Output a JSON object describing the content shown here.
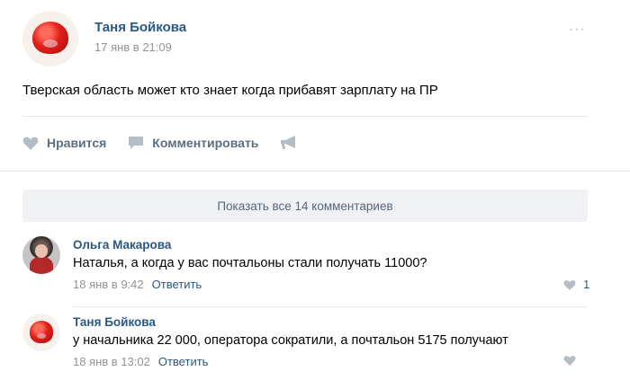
{
  "post": {
    "author": "Таня Бойкова",
    "time": "17 янв в 21:09",
    "more": "···",
    "text": "Тверская область может кто знает когда прибавят зарплату на ПР",
    "actions": {
      "like": "Нравится",
      "comment": "Комментировать"
    }
  },
  "comments": {
    "show_all": "Показать все 14 комментариев",
    "items": [
      {
        "author": "Ольга Макарова",
        "text": "Наталья, а когда у вас почтальоны стали получать 11000?",
        "time": "18 янв в 9:42",
        "reply": "Ответить",
        "likes": "1"
      },
      {
        "author": "Таня Бойкова",
        "text": "у начальника 22 000, оператора сократили, а почтальон 5175 получают",
        "time": "18 янв в 13:02",
        "reply": "Ответить",
        "likes": ""
      }
    ]
  },
  "colors": {
    "link": "#2a5885",
    "muted": "#939393",
    "icon": "#b6bcc4",
    "divider": "#e7e8ec"
  }
}
